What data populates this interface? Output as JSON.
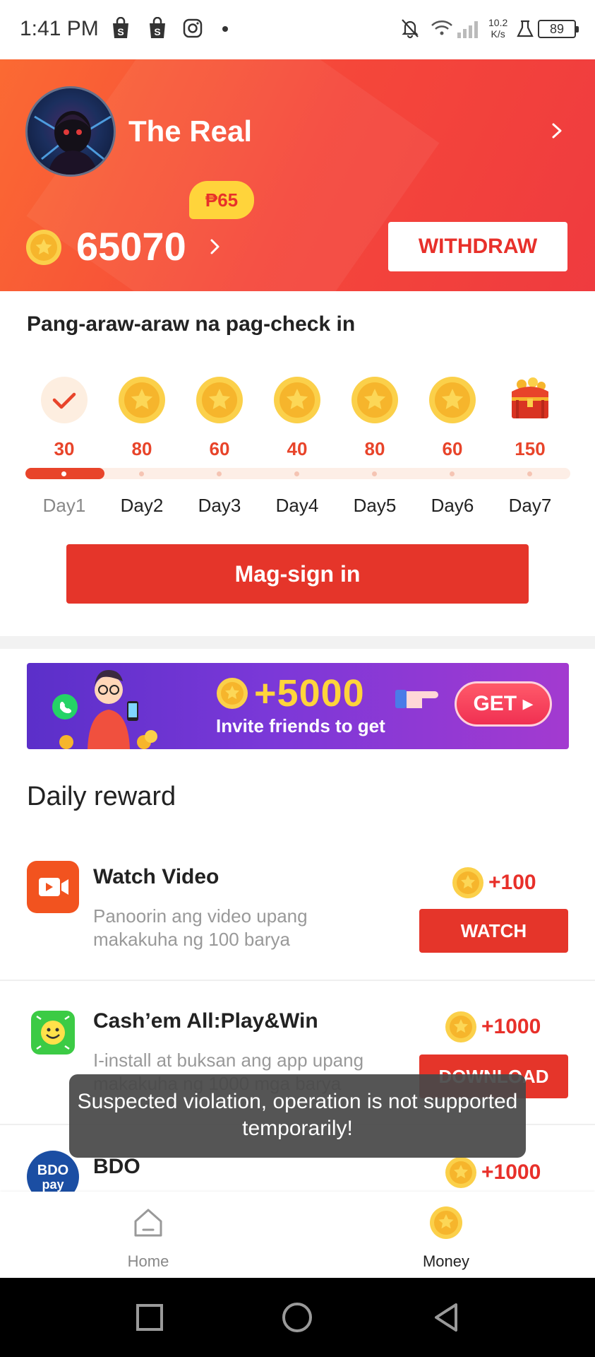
{
  "status_bar": {
    "time": "1:41 PM",
    "speed_value": "10.2",
    "speed_unit": "K/s",
    "battery": "89"
  },
  "header": {
    "username": "The Real",
    "peso_badge": "₱65",
    "balance": "65070",
    "withdraw_label": "WITHDRAW"
  },
  "checkin": {
    "title": "Pang-araw-araw na pag-check in",
    "days": [
      {
        "label": "Day1",
        "value": "30",
        "icon": "check-icon",
        "done": true
      },
      {
        "label": "Day2",
        "value": "80",
        "icon": "coin-icon"
      },
      {
        "label": "Day3",
        "value": "60",
        "icon": "coin-icon"
      },
      {
        "label": "Day4",
        "value": "40",
        "icon": "coin-icon"
      },
      {
        "label": "Day5",
        "value": "80",
        "icon": "coin-icon"
      },
      {
        "label": "Day6",
        "value": "60",
        "icon": "coin-icon"
      },
      {
        "label": "Day7",
        "value": "150",
        "icon": "treasure-chest-icon"
      }
    ],
    "progress_days_completed": 1,
    "signin_label": "Mag-sign in"
  },
  "banner": {
    "amount": "+5000",
    "subtitle": "Invite friends to get",
    "get_label": "GET ▸"
  },
  "daily_reward": {
    "title": "Daily reward",
    "items": [
      {
        "title": "Watch Video",
        "desc": "Panoorin ang video upang makakuha ng 100 barya",
        "reward": "+100",
        "button": "WATCH",
        "icon": "video-icon"
      },
      {
        "title": "Cash’em All:Play&Win",
        "desc": "I-install at buksan ang app upang makakuha ng 1000 mga barya",
        "reward": "+1000",
        "button": "DOWNLOAD",
        "icon": "cashem-app-icon"
      },
      {
        "title": "BDO",
        "reward": "+1000",
        "icon": "bdo-pay-icon",
        "icon_text": "BDO pay"
      }
    ]
  },
  "toast": {
    "message": "Suspected violation, operation is not supported temporarily!"
  },
  "bottom_nav": {
    "items": [
      {
        "label": "Home",
        "icon": "home-icon",
        "active": false
      },
      {
        "label": "Money",
        "icon": "coin-icon",
        "active": true
      }
    ]
  },
  "colors": {
    "accent": "#e5352a",
    "header_start": "#fb6a33",
    "header_end": "#ef3b3f",
    "coin": "#f7c239",
    "banner_purple": "#6a34d0"
  }
}
